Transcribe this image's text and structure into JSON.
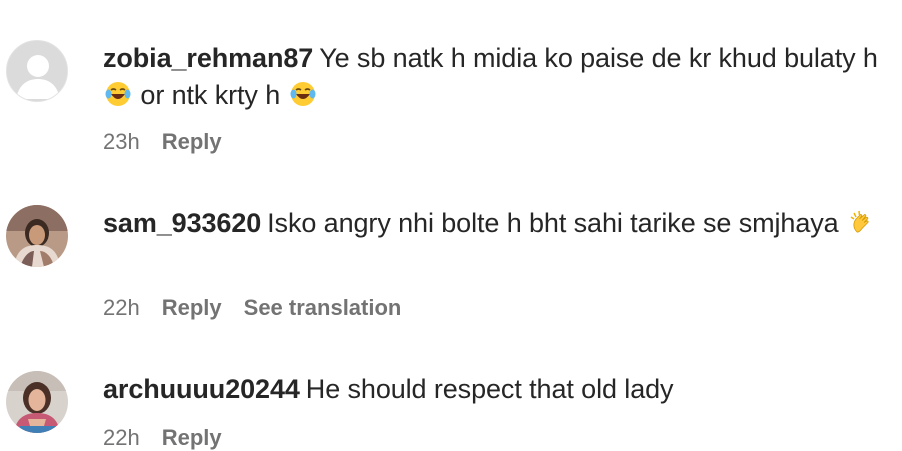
{
  "comments": [
    {
      "username": "zobia_rehman87",
      "text_part1": "Ye sb natk h midia ko paise de kr khud bulaty h",
      "emoji1": "face-with-tears-of-joy",
      "text_part2": "or ntk krty h",
      "emoji2": "face-with-tears-of-joy",
      "time": "23h",
      "reply_label": "Reply"
    },
    {
      "username": "sam_933620",
      "text_part1": "Isko angry nhi bolte h bht sahi tarike se smjhaya",
      "emoji1": "clapping-hands",
      "time": "22h",
      "reply_label": "Reply",
      "translate_label": "See translation"
    },
    {
      "username": "archuuuu20244",
      "text_part1": "He should respect that old lady",
      "time": "22h",
      "reply_label": "Reply"
    }
  ],
  "colors": {
    "text": "#262626",
    "meta": "#737373",
    "default_avatar": "#dbdbdb"
  }
}
